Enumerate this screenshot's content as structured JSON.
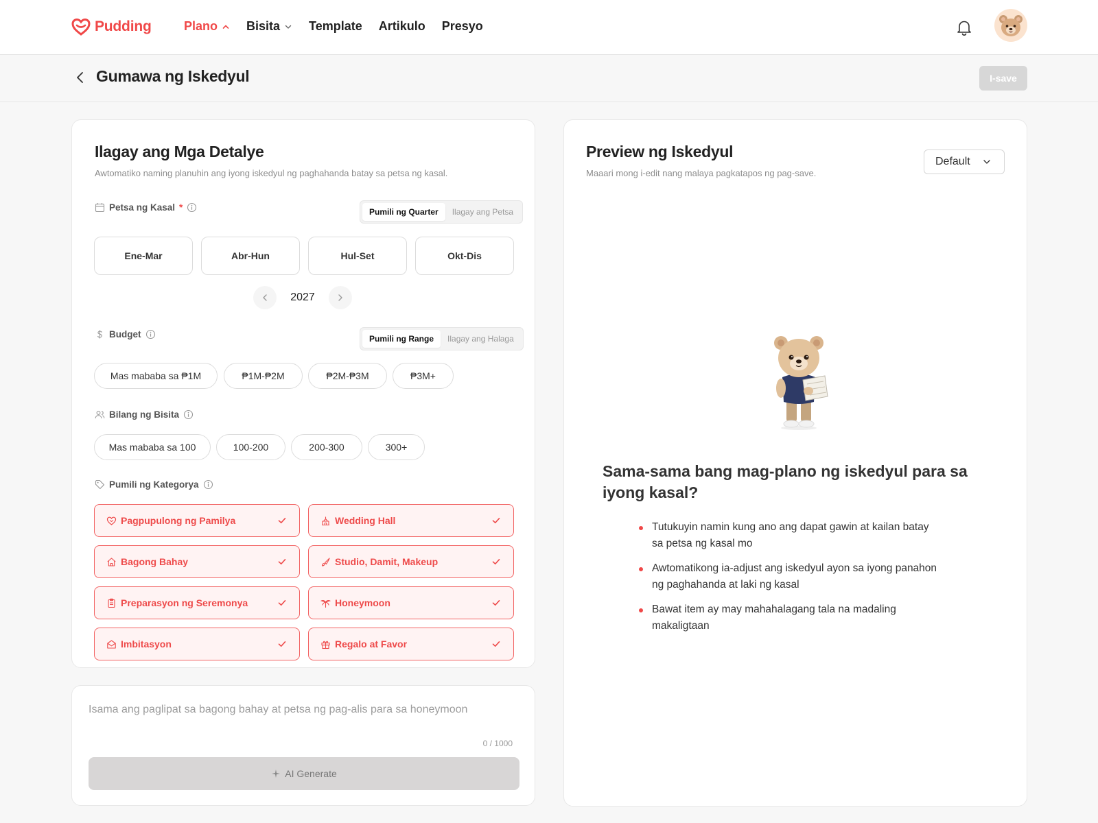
{
  "brand": {
    "name": "Pudding",
    "accent": "#f04848"
  },
  "nav": {
    "items": [
      {
        "label": "Plano",
        "active": true,
        "chevron": "up"
      },
      {
        "label": "Bisita",
        "active": false,
        "chevron": "down"
      },
      {
        "label": "Template",
        "active": false
      },
      {
        "label": "Artikulo",
        "active": false
      },
      {
        "label": "Presyo",
        "active": false
      }
    ],
    "icons": [
      "bell-icon",
      "avatar-bear"
    ]
  },
  "header": {
    "title": "Gumawa ng Iskedyul",
    "save_label": "I-save"
  },
  "details": {
    "title": "Ilagay ang Mga Detalye",
    "subtitle": "Awtomatiko naming planuhin ang iyong iskedyul ng paghahanda batay sa petsa ng kasal.",
    "date": {
      "label": "Petsa ng Kasal",
      "required_mark": "*",
      "modes": [
        "Pumili ng Quarter",
        "Ilagay ang Petsa"
      ],
      "quarters": [
        "Ene-Mar",
        "Abr-Hun",
        "Hul-Set",
        "Okt-Dis"
      ],
      "year": "2027"
    },
    "budget": {
      "label": "Budget",
      "modes": [
        "Pumili ng Range",
        "Ilagay ang Halaga"
      ],
      "options": [
        "Mas mababa sa ₱1M",
        "₱1M-₱2M",
        "₱2M-₱3M",
        "₱3M+"
      ]
    },
    "guests": {
      "label": "Bilang ng Bisita",
      "options": [
        "Mas mababa sa 100",
        "100-200",
        "200-300",
        "300+"
      ]
    },
    "category": {
      "label": "Pumili ng Kategorya",
      "items": [
        {
          "label": "Pagpupulong ng Pamilya",
          "icon": "hearts-icon"
        },
        {
          "label": "Wedding Hall",
          "icon": "hall-icon"
        },
        {
          "label": "Bagong Bahay",
          "icon": "house-icon"
        },
        {
          "label": "Studio, Damit, Makeup",
          "icon": "brush-icon"
        },
        {
          "label": "Preparasyon ng Seremonya",
          "icon": "clipboard-icon"
        },
        {
          "label": "Honeymoon",
          "icon": "palm-icon"
        },
        {
          "label": "Imbitasyon",
          "icon": "envelope-icon"
        },
        {
          "label": "Regalo at Favor",
          "icon": "gift-icon"
        }
      ]
    }
  },
  "notes": {
    "placeholder": "Isama ang paglipat sa bagong bahay at petsa ng pag-alis para sa honeymoon",
    "counter": "0 / 1000",
    "ai_label": "AI Generate"
  },
  "preview": {
    "title": "Preview ng Iskedyul",
    "subtitle": "Maaari mong i-edit nang malaya pagkatapos ng pag-save.",
    "select_value": "Default",
    "promo_title": "Sama-sama bang mag-plano ng iskedyul para sa iyong kasal?",
    "bullets": [
      "Tutukuyin namin kung ano ang dapat gawin at kailan batay sa petsa ng kasal mo",
      "Awtomatikong ia-adjust ang iskedyul ayon sa iyong panahon ng paghahanda at laki ng kasal",
      "Bawat item ay may mahahalagang tala na madaling makaligtaan"
    ]
  }
}
